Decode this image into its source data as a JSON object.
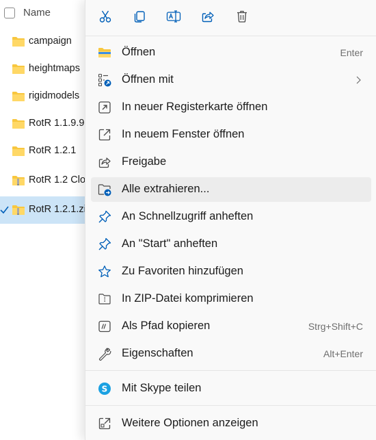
{
  "file_list": {
    "header_label": "Name",
    "items": [
      {
        "name": "campaign",
        "type": "folder"
      },
      {
        "name": "heightmaps",
        "type": "folder"
      },
      {
        "name": "rigidmodels",
        "type": "folder"
      },
      {
        "name": "RotR 1.1.9.9",
        "type": "folder"
      },
      {
        "name": "RotR 1.2.1",
        "type": "folder"
      },
      {
        "name": "RotR 1.2 Clo",
        "type": "zip"
      },
      {
        "name": "RotR 1.2.1.zi",
        "type": "zip",
        "selected": true
      }
    ]
  },
  "context_menu": {
    "toolbar": [
      {
        "icon": "cut-icon"
      },
      {
        "icon": "copy-icon"
      },
      {
        "icon": "rename-icon"
      },
      {
        "icon": "share-icon"
      },
      {
        "icon": "delete-icon"
      }
    ],
    "items": [
      {
        "label": "Öffnen",
        "shortcut": "Enter",
        "icon": "folder-open-icon"
      },
      {
        "label": "Öffnen mit",
        "shortcut": "",
        "icon": "open-with-icon",
        "submenu": true
      },
      {
        "label": "In neuer Registerkarte öffnen",
        "shortcut": "",
        "icon": "new-tab-icon"
      },
      {
        "label": "In neuem Fenster öffnen",
        "shortcut": "",
        "icon": "new-window-icon"
      },
      {
        "label": "Freigabe",
        "shortcut": "",
        "icon": "share-icon"
      },
      {
        "label": "Alle extrahieren...",
        "shortcut": "",
        "icon": "extract-icon",
        "hover": true
      },
      {
        "label": "An Schnellzugriff anheften",
        "shortcut": "",
        "icon": "pin-icon"
      },
      {
        "label": "An \"Start\" anheften",
        "shortcut": "",
        "icon": "pin-icon"
      },
      {
        "label": "Zu Favoriten hinzufügen",
        "shortcut": "",
        "icon": "star-icon"
      },
      {
        "label": "In ZIP-Datei komprimieren",
        "shortcut": "",
        "icon": "zip-icon"
      },
      {
        "label": "Als Pfad kopieren",
        "shortcut": "Strg+Shift+C",
        "icon": "copy-path-icon"
      },
      {
        "label": "Eigenschaften",
        "shortcut": "Alt+Enter",
        "icon": "wrench-icon"
      },
      {
        "label": "Mit Skype teilen",
        "shortcut": "",
        "icon": "skype-icon"
      },
      {
        "label": "Weitere Optionen anzeigen",
        "shortcut": "",
        "icon": "more-options-icon"
      }
    ]
  },
  "colors": {
    "menu_background": "#f9f9f9",
    "hover_background": "#ececec",
    "selection_background": "#cce4f7",
    "accent_blue": "#005fb8",
    "folder_yellow": "#f8c73f",
    "skype_blue": "#1ba1e2"
  }
}
